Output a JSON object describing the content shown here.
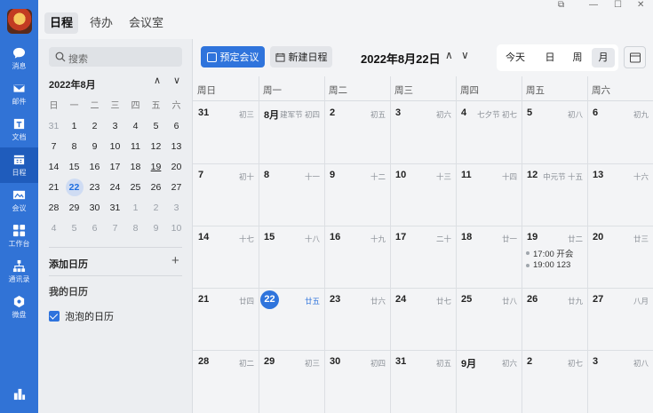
{
  "nav": {
    "items": [
      {
        "label": "消息",
        "icon": "chat-icon"
      },
      {
        "label": "邮件",
        "icon": "mail-icon"
      },
      {
        "label": "文档",
        "icon": "doc-icon"
      },
      {
        "label": "日程",
        "icon": "calendar-icon"
      },
      {
        "label": "会议",
        "icon": "meeting-icon"
      },
      {
        "label": "工作台",
        "icon": "apps-icon"
      },
      {
        "label": "通讯录",
        "icon": "contacts-icon"
      },
      {
        "label": "微盘",
        "icon": "drive-icon"
      }
    ]
  },
  "tabs": [
    "日程",
    "待办",
    "会议室"
  ],
  "window": {
    "more": "···"
  },
  "search": {
    "placeholder": "搜索"
  },
  "mini": {
    "month": "2022年8月",
    "weekdays": [
      "日",
      "一",
      "二",
      "三",
      "四",
      "五",
      "六"
    ],
    "weeks": [
      [
        "31",
        "1",
        "2",
        "3",
        "4",
        "5",
        "6"
      ],
      [
        "7",
        "8",
        "9",
        "10",
        "11",
        "12",
        "13"
      ],
      [
        "14",
        "15",
        "16",
        "17",
        "18",
        "19",
        "20"
      ],
      [
        "21",
        "22",
        "23",
        "24",
        "25",
        "26",
        "27"
      ],
      [
        "28",
        "29",
        "30",
        "31",
        "1",
        "2",
        "3"
      ],
      [
        "4",
        "5",
        "6",
        "7",
        "8",
        "9",
        "10"
      ]
    ]
  },
  "side": {
    "add_calendar": "添加日历",
    "add_symbol": "+",
    "my_calendars": "我的日历",
    "calendar_name": "泡泡的日历"
  },
  "toolbar": {
    "book_meeting": "预定会议",
    "new_event": "新建日程",
    "current_date": "2022年8月22日",
    "today": "今天",
    "day": "日",
    "week": "周",
    "month": "月"
  },
  "grid": {
    "weekdays": [
      "周日",
      "周一",
      "周二",
      "周三",
      "周四",
      "周五",
      "周六"
    ],
    "weeks": [
      [
        {
          "d": "31",
          "l": "初三"
        },
        {
          "d": "8月",
          "l": "建军节 初四"
        },
        {
          "d": "2",
          "l": "初五"
        },
        {
          "d": "3",
          "l": "初六"
        },
        {
          "d": "4",
          "l": "七夕节 初七"
        },
        {
          "d": "5",
          "l": "初八"
        },
        {
          "d": "6",
          "l": "初九"
        }
      ],
      [
        {
          "d": "7",
          "l": "初十"
        },
        {
          "d": "8",
          "l": "十一"
        },
        {
          "d": "9",
          "l": "十二"
        },
        {
          "d": "10",
          "l": "十三"
        },
        {
          "d": "11",
          "l": "十四"
        },
        {
          "d": "12",
          "l": "中元节 十五"
        },
        {
          "d": "13",
          "l": "十六"
        }
      ],
      [
        {
          "d": "14",
          "l": "十七"
        },
        {
          "d": "15",
          "l": "十八"
        },
        {
          "d": "16",
          "l": "十九"
        },
        {
          "d": "17",
          "l": "二十"
        },
        {
          "d": "18",
          "l": "廿一"
        },
        {
          "d": "19",
          "l": "廿二"
        },
        {
          "d": "20",
          "l": "廿三"
        }
      ],
      [
        {
          "d": "21",
          "l": "廿四"
        },
        {
          "d": "22",
          "l": "廿五"
        },
        {
          "d": "23",
          "l": "廿六"
        },
        {
          "d": "24",
          "l": "廿七"
        },
        {
          "d": "25",
          "l": "廿八"
        },
        {
          "d": "26",
          "l": "廿九"
        },
        {
          "d": "27",
          "l": "八月"
        }
      ],
      [
        {
          "d": "28",
          "l": "初二"
        },
        {
          "d": "29",
          "l": "初三"
        },
        {
          "d": "30",
          "l": "初四"
        },
        {
          "d": "31",
          "l": "初五"
        },
        {
          "d": "9月",
          "l": "初六"
        },
        {
          "d": "2",
          "l": "初七"
        },
        {
          "d": "3",
          "l": "初八"
        }
      ]
    ],
    "events": [
      "17:00 开会",
      "19:00 123"
    ]
  },
  "colors": {
    "accent": "#2f74dc",
    "rail": "#3173d6"
  }
}
